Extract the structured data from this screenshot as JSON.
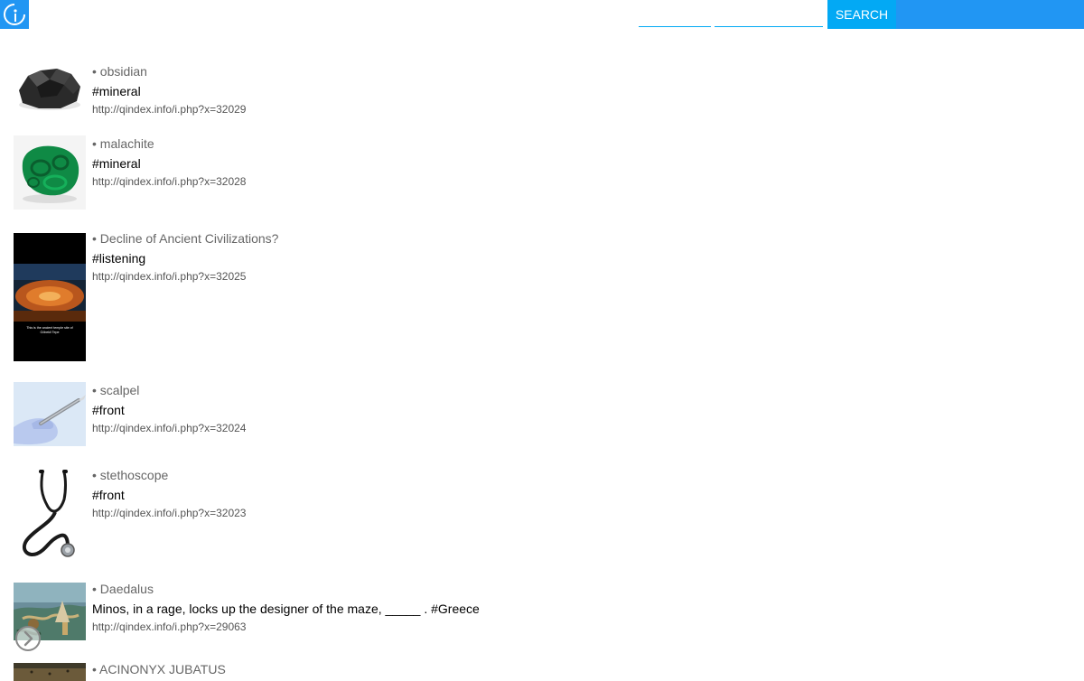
{
  "header": {
    "logo_icon": "qindex-logo-icon",
    "field1": {
      "value": "",
      "placeholder": ""
    },
    "field2": {
      "value": "",
      "placeholder": ""
    },
    "search_label": "SEARCH",
    "accent_color": "#2196f3",
    "button_color": "#03a9f4"
  },
  "results": [
    {
      "title": "• obsidian",
      "desc": "#mineral",
      "url": "http://qindex.info/i.php?x=32029",
      "thumb": "obsidian-image"
    },
    {
      "title": "• malachite",
      "desc": "#mineral",
      "url": "http://qindex.info/i.php?x=32028",
      "thumb": "malachite-image"
    },
    {
      "title": "• Decline of Ancient Civilizations?",
      "desc": "#listening",
      "url": "http://qindex.info/i.php?x=32025",
      "thumb": "ancient-temple-video-image",
      "thumb_caption_1": "This is the ancient temple site of",
      "thumb_caption_2": "Göbekli Tepe"
    },
    {
      "title": "• scalpel",
      "desc": "#front",
      "url": "http://qindex.info/i.php?x=32024",
      "thumb": "scalpel-image"
    },
    {
      "title": "• stethoscope",
      "desc": "#front",
      "url": "http://qindex.info/i.php?x=32023",
      "thumb": "stethoscope-image"
    },
    {
      "title": "• Daedalus",
      "desc": "Minos, in a rage, locks up the designer of the maze, _____ . #Greece",
      "url": "http://qindex.info/i.php?x=29063",
      "thumb": "daedalus-painting-image"
    },
    {
      "title": "• ACINONYX JUBATUS",
      "desc": "",
      "url": "",
      "thumb": "cheetah-image"
    }
  ],
  "scroll_button_icon": "arrow-right-circle-icon"
}
